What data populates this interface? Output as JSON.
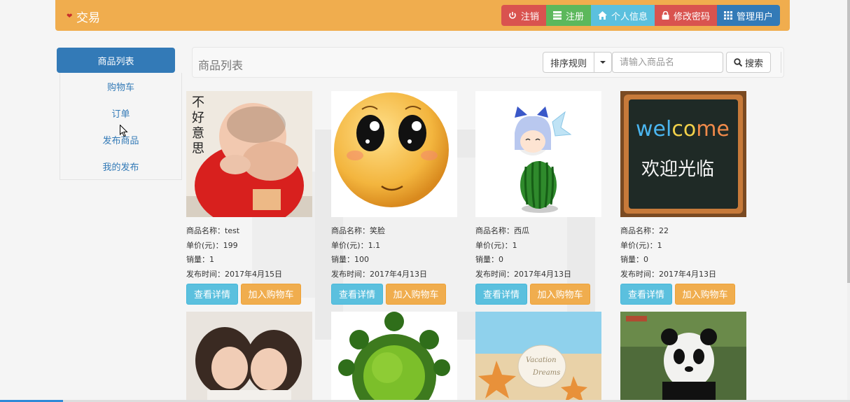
{
  "brand": {
    "title": "交易"
  },
  "nav": {
    "logout": "注销",
    "register": "注册",
    "profile": "个人信息",
    "change_password": "修改密码",
    "manage_users": "管理用户"
  },
  "sidebar": {
    "items": [
      {
        "label": "商品列表",
        "active": true
      },
      {
        "label": "购物车"
      },
      {
        "label": "订单"
      },
      {
        "label": "发布商品"
      },
      {
        "label": "我的发布"
      }
    ]
  },
  "toolbar": {
    "title": "商品列表",
    "sort_label": "排序规则",
    "search_placeholder": "请输入商品名",
    "search_label": "搜索"
  },
  "products": [
    {
      "image": "baby-shy",
      "image_text": "不好意思",
      "name_line": "商品名称：test",
      "price_line": "单价(元)：199",
      "sales_line": "销量：1",
      "date_line": "发布时间：2017年4月15日",
      "detail": "查看详情",
      "cart": "加入购物车"
    },
    {
      "image": "smiley-face",
      "name_line": "商品名称：笑脸",
      "price_line": "单价(元)：1.1",
      "sales_line": "销量：100",
      "date_line": "发布时间：2017年4月13日",
      "detail": "查看详情",
      "cart": "加入购物车"
    },
    {
      "image": "anime-watermelon",
      "name_line": "商品名称：西瓜",
      "price_line": "单价(元)：1",
      "sales_line": "销量：0",
      "date_line": "发布时间：2017年4月13日",
      "detail": "查看详情",
      "cart": "加入购物车"
    },
    {
      "image": "welcome-chalkboard",
      "image_text_1": "welcome",
      "image_text_2": "欢迎光临",
      "name_line": "商品名称：22",
      "price_line": "单价(元)：1",
      "sales_line": "销量：0",
      "date_line": "发布时间：2017年4月13日",
      "detail": "查看详情",
      "cart": "加入购物车"
    }
  ],
  "products_row2": [
    {
      "image": "two-girls"
    },
    {
      "image": "tree-globe"
    },
    {
      "image": "beach-starfish",
      "image_text": "Vacation Dreams"
    },
    {
      "image": "panda"
    }
  ]
}
